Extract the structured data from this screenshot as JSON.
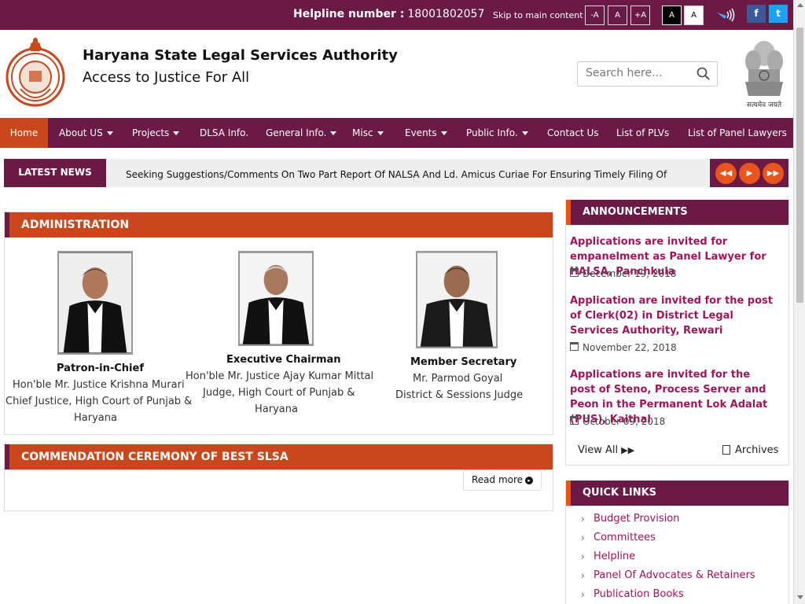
{
  "topbar": {
    "helpline_label": "Helpline number :",
    "helpline_number": "18001802057",
    "skip_link": "Skip to main content",
    "font_small": "-A",
    "font_normal": "A",
    "font_large": "+A",
    "contrast_dark": "A",
    "contrast_light": "A",
    "screen_reader_icon": "screen-reader-icon",
    "facebook": "f",
    "twitter": "t"
  },
  "header": {
    "title": "Haryana State Legal Services Authority",
    "subtitle": "Access to Justice For All",
    "search_placeholder": "Search here...",
    "emblem_motto": "सत्यमेव जयते"
  },
  "nav": {
    "items": [
      {
        "label": "Home"
      },
      {
        "label": "About US"
      },
      {
        "label": "Projects"
      },
      {
        "label": "DLSA Info."
      },
      {
        "label": "General Info."
      },
      {
        "label": "Misc"
      },
      {
        "label": "Events"
      },
      {
        "label": "Public Info."
      },
      {
        "label": "Contact Us"
      },
      {
        "label": "List of PLVs"
      },
      {
        "label": "List of Panel Lawyers"
      }
    ]
  },
  "news": {
    "label": "LATEST NEWS",
    "text": "Seeking Suggestions/Comments On Two Part Report Of NALSA And Ld. Amicus Curiae For Ensuring Timely Filing Of Appeals On Behalf Of Convicts"
  },
  "administration": {
    "heading": "ADMINISTRATION",
    "people": [
      {
        "role": "Patron-in-Chief",
        "name": "Hon'ble Mr. Justice Krishna Murari",
        "line2": "Chief Justice, High Court of Punjab &",
        "line3": "Haryana"
      },
      {
        "role": "Executive Chairman",
        "name": "Hon'ble Mr. Justice Ajay Kumar Mittal",
        "line2": "Judge, High Court of Punjab &",
        "line3": "Haryana"
      },
      {
        "role": "Member Secretary",
        "name": "Mr. Parmod Goyal",
        "line2": "District & Sessions Judge"
      }
    ]
  },
  "commendation": {
    "heading": "COMMENDATION CEREMONY OF BEST SLSA",
    "read_more": "Read more"
  },
  "announcements": {
    "heading": "ANNOUNCEMENTS",
    "items": [
      {
        "title": "Applications are invited for empanelment as Panel Lawyer for HALSA, Panchkula",
        "date": "December 19, 2018"
      },
      {
        "title": "Application are invited for the post of Clerk(02) in District Legal Services Authority, Rewari",
        "date": "November 22, 2018"
      },
      {
        "title": "Applications are invited for the post of Steno, Process Server and Peon in the Permanent Lok Adalat (PUS), Kaithal",
        "date": "October 09, 2018"
      }
    ],
    "view_all": "View All",
    "archives": "Archives"
  },
  "quick_links": {
    "heading": "QUICK LINKS",
    "items": [
      {
        "label": "Budget Provision"
      },
      {
        "label": "Committees"
      },
      {
        "label": "Helpline"
      },
      {
        "label": "Panel Of Advocates & Retainers"
      },
      {
        "label": "Publication Books"
      }
    ]
  },
  "colors": {
    "primary": "#6b1a45",
    "accent": "#c9471b",
    "link": "#a0155a"
  }
}
